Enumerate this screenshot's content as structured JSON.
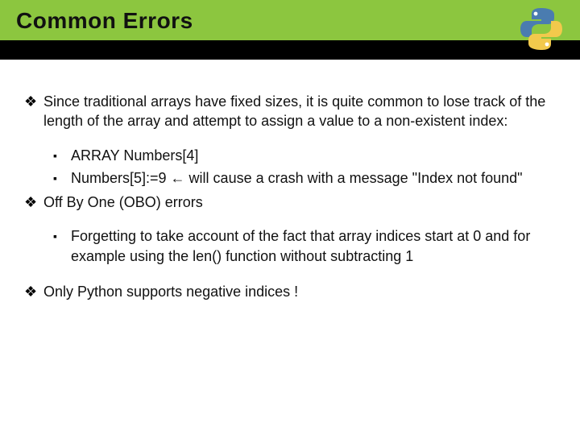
{
  "header": {
    "title": "Common Errors"
  },
  "bullets": {
    "b1": "Since traditional arrays have fixed sizes, it is quite common to lose track of the length of the array and attempt to assign a value to a non-existent index:",
    "b1_sub1": "ARRAY Numbers[4]",
    "b1_sub2": "Numbers[5]:=9 ← will cause a crash with a message \"Index not found\"",
    "b2": "Off By One (OBO) errors",
    "b2_sub1": "Forgetting to take account of the fact that array indices start at 0 and for example using the len() function without subtracting 1",
    "b3": "Only Python supports negative indices !"
  },
  "markers": {
    "diamond": "❖",
    "square": "▪"
  }
}
